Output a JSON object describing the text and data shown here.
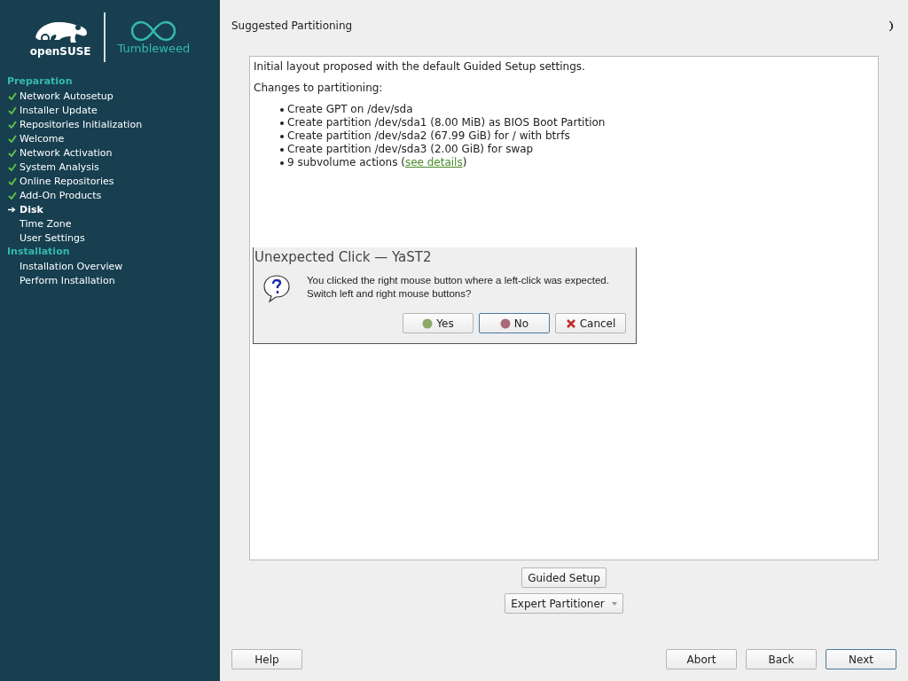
{
  "sidebar": {
    "logo": {
      "brand": "openSUSE",
      "product": "Tumbleweed"
    },
    "sections": [
      {
        "title": "Preparation",
        "items": [
          {
            "label": "Network Autosetup",
            "done": true,
            "current": false
          },
          {
            "label": "Installer Update",
            "done": true,
            "current": false
          },
          {
            "label": "Repositories Initialization",
            "done": true,
            "current": false
          },
          {
            "label": "Welcome",
            "done": true,
            "current": false
          },
          {
            "label": "Network Activation",
            "done": true,
            "current": false
          },
          {
            "label": "System Analysis",
            "done": true,
            "current": false
          },
          {
            "label": "Online Repositories",
            "done": true,
            "current": false
          },
          {
            "label": "Add-On Products",
            "done": true,
            "current": false
          },
          {
            "label": "Disk",
            "done": false,
            "current": true
          },
          {
            "label": "Time Zone",
            "done": false,
            "current": false
          },
          {
            "label": "User Settings",
            "done": false,
            "current": false
          }
        ]
      },
      {
        "title": "Installation",
        "items": [
          {
            "label": "Installation Overview",
            "done": false,
            "current": false
          },
          {
            "label": "Perform Installation",
            "done": false,
            "current": false
          }
        ]
      }
    ]
  },
  "page": {
    "title": "Suggested Partitioning",
    "summary": {
      "intro": "Initial layout proposed with the default Guided Setup settings.",
      "heading": "Changes to partitioning:",
      "changes": [
        {
          "text": "Create GPT on /dev/sda"
        },
        {
          "text": "Create partition /dev/sda1 (8.00 MiB) as BIOS Boot Partition"
        },
        {
          "text": "Create partition /dev/sda2 (67.99 GiB) for / with btrfs"
        },
        {
          "text": "Create partition /dev/sda3 (2.00 GiB) for swap"
        },
        {
          "text": "9 subvolume actions (",
          "link": "see details",
          "after": ")"
        }
      ]
    },
    "guided_setup": "Guided Setup",
    "expert_partitioner": "Expert Partitioner"
  },
  "dialog": {
    "title": "Unexpected Click — YaST2",
    "message": "You clicked the right mouse button where a left-click was expected.\nSwitch left and right mouse buttons?",
    "buttons": [
      {
        "label": "Yes",
        "kind": "yes",
        "focused": false
      },
      {
        "label": "No",
        "kind": "no",
        "focused": true
      },
      {
        "label": "Cancel",
        "kind": "cancel",
        "focused": false
      }
    ]
  },
  "footer": {
    "help": "Help",
    "buttons": [
      {
        "label": "Abort",
        "focused": false
      },
      {
        "label": "Back",
        "focused": false
      },
      {
        "label": "Next",
        "focused": true
      }
    ]
  }
}
